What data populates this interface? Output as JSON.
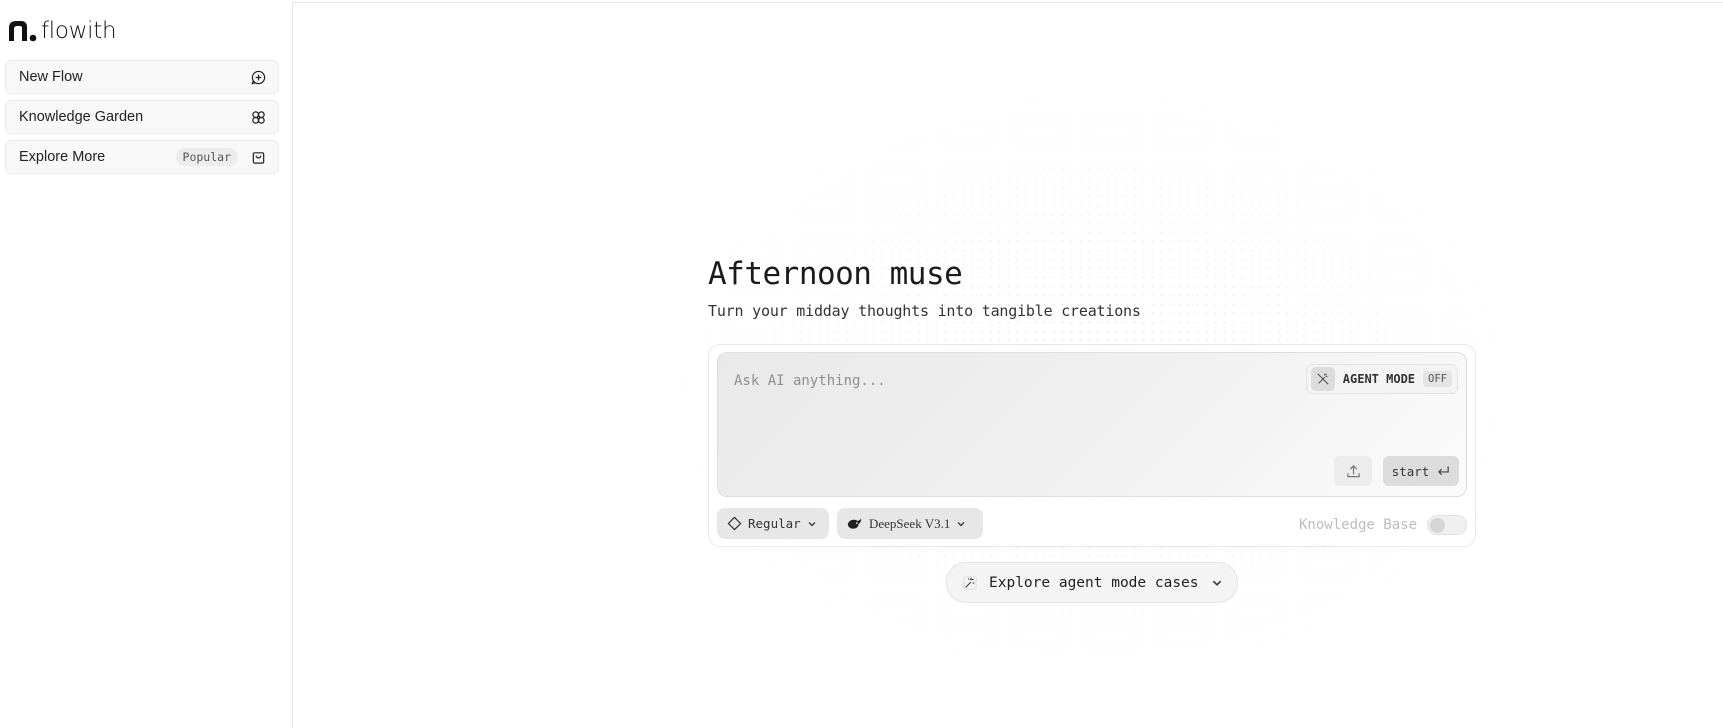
{
  "app": {
    "name": "flowith"
  },
  "sidebar": {
    "items": [
      {
        "label": "New Flow",
        "icon": "chat-plus-icon"
      },
      {
        "label": "Knowledge Garden",
        "icon": "flower-icon"
      },
      {
        "label": "Explore More",
        "badge": "Popular",
        "icon": "shopping-bag-icon"
      }
    ]
  },
  "main": {
    "headline": "Afternoon muse",
    "subline": "Turn your midday thoughts into tangible creations",
    "composer": {
      "placeholder": "Ask AI anything...",
      "agent_mode_label": "AGENT MODE",
      "agent_mode_state": "OFF",
      "start_label": "start",
      "mode_label": "Regular",
      "model_label": "DeepSeek V3.1",
      "knowledge_base_label": "Knowledge Base",
      "knowledge_base_enabled": false
    },
    "explore_label": "Explore agent mode cases"
  }
}
